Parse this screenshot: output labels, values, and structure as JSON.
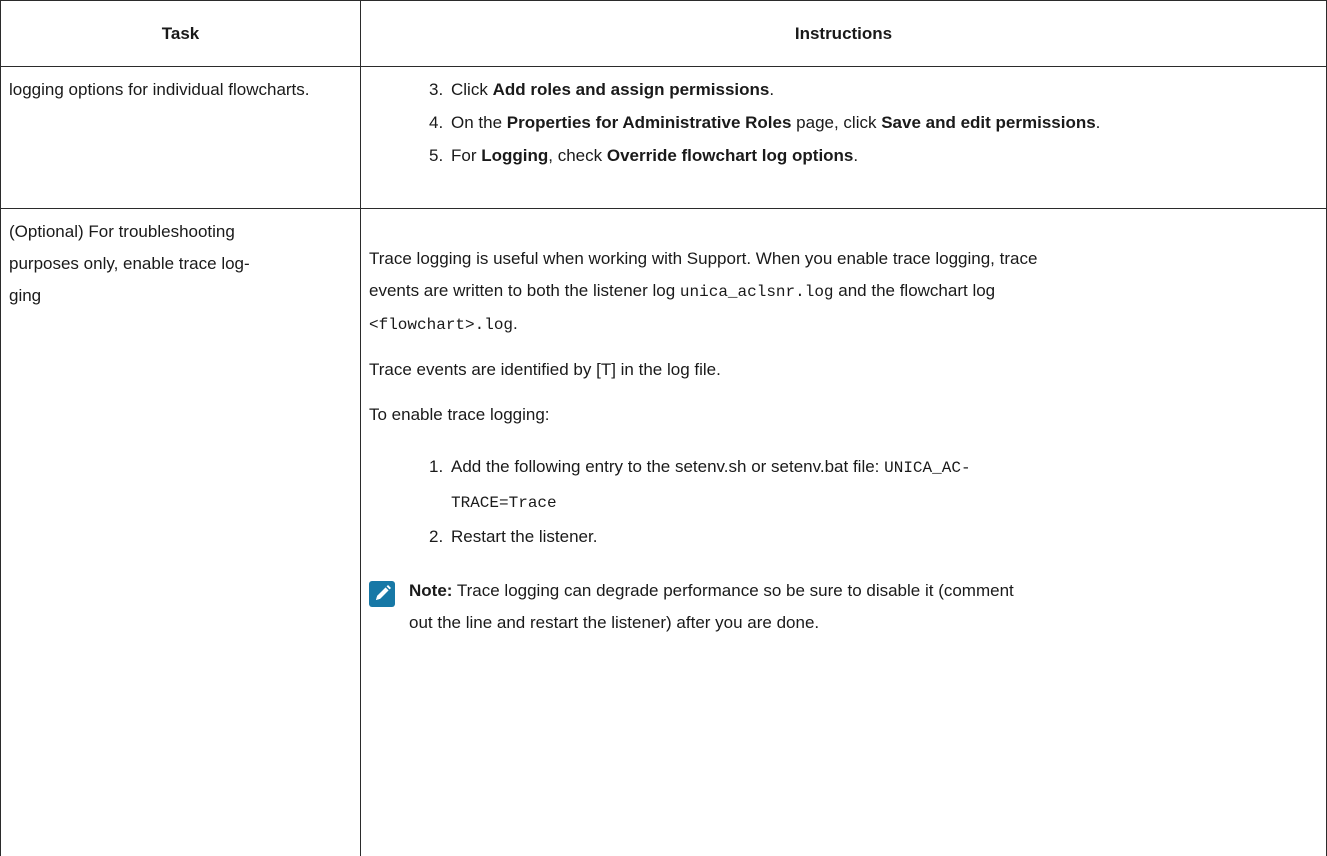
{
  "table": {
    "headers": {
      "task": "Task",
      "instructions": "Instructions"
    },
    "rows": [
      {
        "task": "logging options for individual flowcharts.",
        "steps": [
          {
            "num": "3.",
            "pre": "Click ",
            "b1": "Add roles and assign permissions",
            "mid": "",
            "b2": "",
            "post": "."
          },
          {
            "num": "4.",
            "pre": "On the ",
            "b1": "Properties for Administrative Roles",
            "mid": " page, click ",
            "b2": "Save and edit permissions",
            "post": "."
          },
          {
            "num": "5.",
            "pre": "For ",
            "b1": "Logging",
            "mid": ", check ",
            "b2": "Override flowchart log options",
            "post": "."
          }
        ]
      },
      {
        "task_line1": "(Optional) For troubleshooting",
        "task_line2": "purposes only, enable trace log-",
        "task_line3": "ging",
        "intro": {
          "line1": "Trace logging is useful when working with Support. When you enable trace logging, trace",
          "line2_pre": "events are written to both the listener log ",
          "line2_code": "unica_aclsnr.log",
          "line2_post": " and the flowchart log",
          "line3_code": "<flowchart>.log",
          "line3_post": "."
        },
        "trace_events": "Trace events are identified by [T] in the log file.",
        "enable_lead": "To enable trace logging:",
        "steps": [
          {
            "num": "1.",
            "text": "Add the following entry to the setenv.sh or setenv.bat file: ",
            "code1": "UNICA_AC-",
            "code2": "TRACE=Trace"
          },
          {
            "num": "2.",
            "text": "Restart the listener."
          }
        ],
        "note": {
          "label": "Note:",
          "line1": " Trace logging can degrade performance so be sure to disable it (comment",
          "line2": "out the line and restart the listener) after you are done."
        }
      }
    ]
  },
  "icons": {
    "note_icon": "pencil-icon",
    "note_color": "#1778a6"
  }
}
